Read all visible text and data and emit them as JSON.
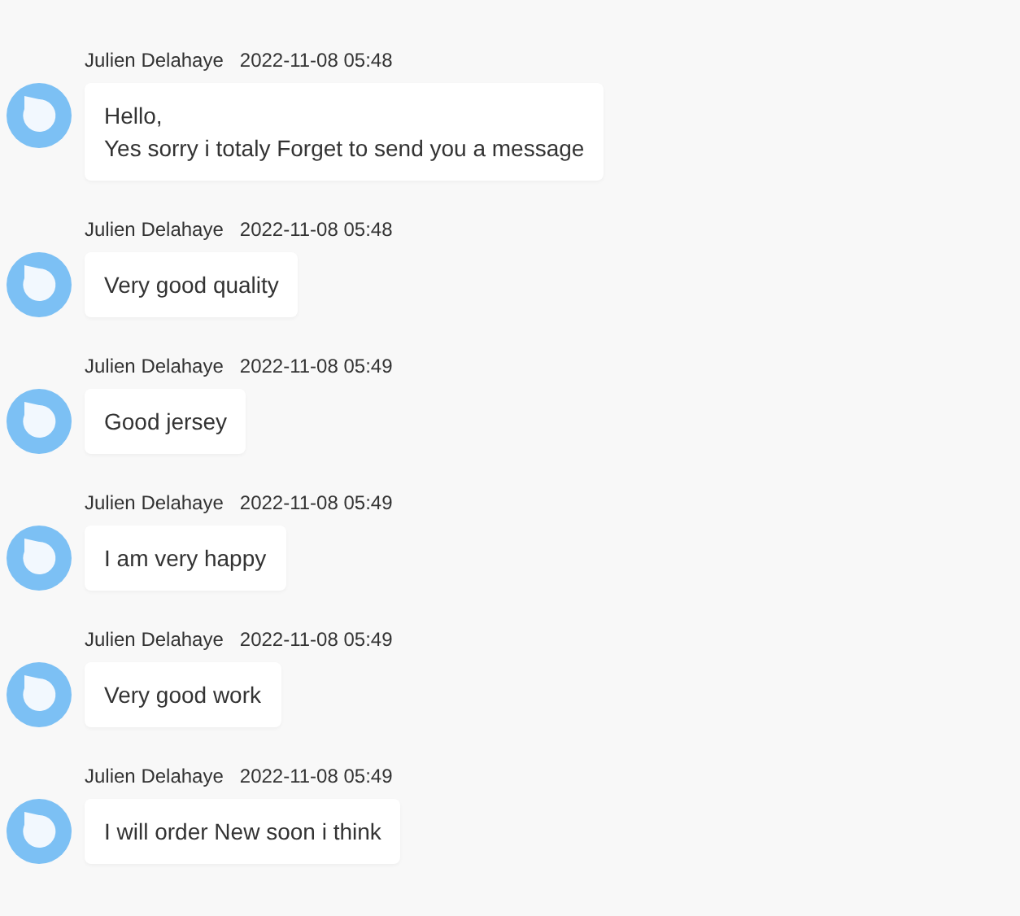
{
  "messages": [
    {
      "sender": "Julien Delahaye",
      "time": "2022-11-08 05:48",
      "text": "Hello,\nYes sorry i totaly Forget to send you a message"
    },
    {
      "sender": "Julien Delahaye",
      "time": "2022-11-08 05:48",
      "text": "Very good quality"
    },
    {
      "sender": "Julien Delahaye",
      "time": "2022-11-08 05:49",
      "text": "Good jersey"
    },
    {
      "sender": "Julien Delahaye",
      "time": "2022-11-08 05:49",
      "text": "I am very happy"
    },
    {
      "sender": "Julien Delahaye",
      "time": "2022-11-08 05:49",
      "text": "Very good work"
    },
    {
      "sender": "Julien Delahaye",
      "time": "2022-11-08 05:49",
      "text": "I will order New soon i think"
    }
  ]
}
